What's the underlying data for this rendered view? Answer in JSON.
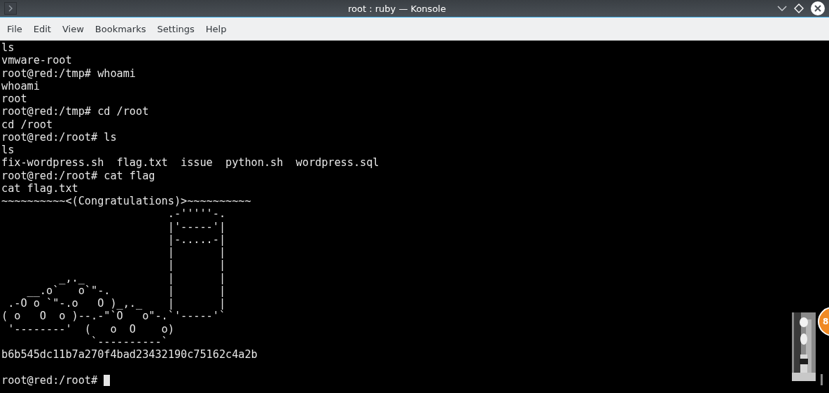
{
  "window": {
    "title": "root : ruby — Konsole"
  },
  "menu": [
    "File",
    "Edit",
    "View",
    "Bookmarks",
    "Settings",
    "Help"
  ],
  "terminal": {
    "lines": [
      "ls",
      "vmware-root",
      "root@red:/tmp# whoami",
      "whoami",
      "root",
      "root@red:/tmp# cd /root",
      "cd /root",
      "root@red:/root# ls",
      "ls",
      "fix-wordpress.sh  flag.txt  issue  python.sh  wordpress.sql",
      "root@red:/root# cat flag",
      "cat flag.txt",
      "~~~~~~~~~~<(Congratulations)>~~~~~~~~~~",
      "                          .-'''''-.",
      "                          |'-----'|",
      "                          |-.....-|",
      "                          |       |",
      "                          |       |",
      "         _,._             |       |",
      "    __.o`   o`\"-.         |       |",
      " .-O o `\"-.o   O )_,._    |       |",
      "( o   O  o )--.-\"`O   o\"-.`'-----'`",
      " '--------'  (   o  O    o)",
      "              `----------`",
      "b6b545dc11b7a270f4bad23432190c75162c4a2b"
    ],
    "prompt": {
      "text": "root@red:/root# ",
      "cursor": true
    }
  },
  "overlay": {
    "badge": "8"
  }
}
